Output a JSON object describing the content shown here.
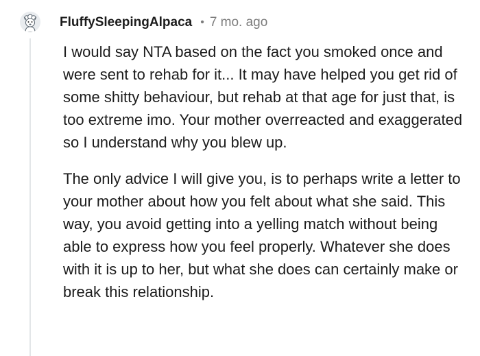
{
  "comment": {
    "author": "FluffySleepingAlpaca",
    "separator": "•",
    "age": "7 mo. ago",
    "avatar_icon": "alpaca-avatar-icon",
    "paragraphs": [
      "I would say NTA based on the fact you smoked once and were sent to rehab for it... It may have helped you get rid of some shitty behaviour, but rehab at that age for just that, is too extreme imo. Your mother overreacted and exaggerated so I understand why you blew up.",
      "The only advice I will give you, is to perhaps write a letter to your mother about how you felt about what she said. This way, you avoid getting into a yelling match without being able to express how you feel properly. Whatever she does with it is up to her, but what she does can certainly make or break this relationship."
    ]
  }
}
